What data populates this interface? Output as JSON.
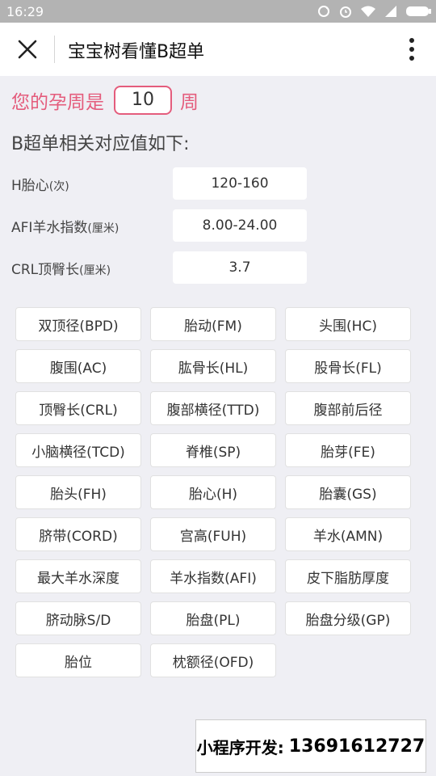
{
  "status_bar": {
    "time": "16:29",
    "icons": [
      "sync-icon",
      "alarm-icon",
      "wifi-icon",
      "signal-icon",
      "battery-icon"
    ]
  },
  "navbar": {
    "title": "宝宝树看懂B超单",
    "close_icon": "close-icon",
    "more_icon": "more-vertical-icon"
  },
  "pregnancy": {
    "prefix": "您的孕周是",
    "week_value": "10",
    "suffix": "周"
  },
  "section_heading": "B超单相关对应值如下:",
  "values": [
    {
      "label": "H胎心",
      "unit": "(次)",
      "value": "120-160"
    },
    {
      "label": "AFI羊水指数",
      "unit": "(厘米)",
      "value": "8.00-24.00"
    },
    {
      "label": "CRL顶臀长",
      "unit": "(厘米)",
      "value": "3.7"
    }
  ],
  "terms": [
    "双顶径(BPD)",
    "胎动(FM)",
    "头围(HC)",
    "腹围(AC)",
    "肱骨长(HL)",
    "股骨长(FL)",
    "顶臀长(CRL)",
    "腹部横径(TTD)",
    "腹部前后径",
    "小脑横径(TCD)",
    "脊椎(SP)",
    "胎芽(FE)",
    "胎头(FH)",
    "胎心(H)",
    "胎囊(GS)",
    "脐带(CORD)",
    "宫高(FUH)",
    "羊水(AMN)",
    "最大羊水深度",
    "羊水指数(AFI)",
    "皮下脂肪厚度",
    "脐动脉S/D",
    "胎盘(PL)",
    "胎盘分级(GP)",
    "胎位",
    "枕额径(OFD)"
  ],
  "promo": {
    "label": "小程序开发:",
    "phone": "13691612727"
  },
  "colors": {
    "accent_pink": "#e45c7c",
    "background": "#efeff4",
    "status_bar": "#b3b3b3"
  }
}
